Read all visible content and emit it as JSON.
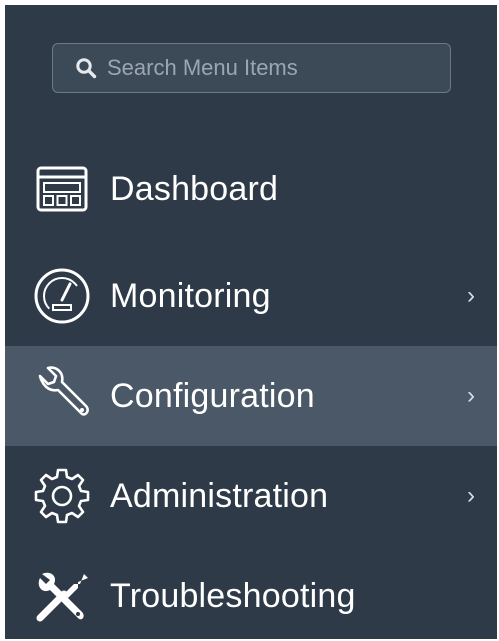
{
  "search": {
    "placeholder": "Search Menu Items"
  },
  "menu": {
    "items": [
      {
        "label": "Dashboard",
        "icon": "dashboard-icon",
        "has_submenu": false,
        "active": false
      },
      {
        "label": "Monitoring",
        "icon": "gauge-icon",
        "has_submenu": true,
        "active": false
      },
      {
        "label": "Configuration",
        "icon": "wrench-icon",
        "has_submenu": true,
        "active": true
      },
      {
        "label": "Administration",
        "icon": "gear-icon",
        "has_submenu": true,
        "active": false
      },
      {
        "label": "Troubleshooting",
        "icon": "tools-icon",
        "has_submenu": false,
        "active": false
      }
    ],
    "chevron": "›"
  },
  "colors": {
    "background": "#2e3a47",
    "active_background": "#4a5867",
    "text": "#ffffff",
    "search_background": "#3c4957",
    "search_border": "#6b7886"
  }
}
